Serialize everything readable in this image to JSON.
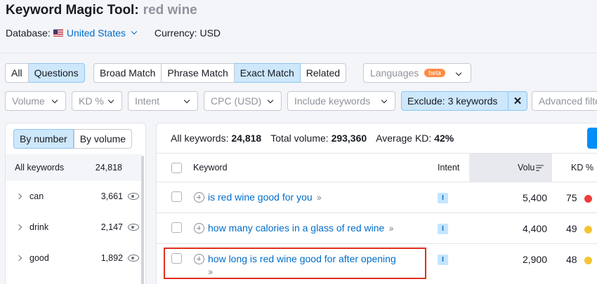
{
  "header": {
    "tool_title": "Keyword Magic Tool:",
    "query": "red wine",
    "database_label": "Database:",
    "database_value": "United States",
    "currency": "Currency: USD"
  },
  "tabs_scope": [
    "All",
    "Questions"
  ],
  "tabs_match": [
    "Broad Match",
    "Phrase Match",
    "Exact Match",
    "Related"
  ],
  "languages": {
    "label": "Languages",
    "badge": "beta"
  },
  "filters": {
    "volume": "Volume",
    "kd": "KD %",
    "intent": "Intent",
    "cpc": "CPC (USD)",
    "include": "Include keywords",
    "exclude": "Exclude: 3 keywords",
    "advanced": "Advanced filters"
  },
  "sidebar": {
    "by_number": "By number",
    "by_volume": "By volume",
    "all_label": "All keywords",
    "all_count": "24,818",
    "groups": [
      {
        "name": "can",
        "count": "3,661"
      },
      {
        "name": "drink",
        "count": "2,147"
      },
      {
        "name": "good",
        "count": "1,892"
      }
    ]
  },
  "summary": {
    "all_label": "All keywords:",
    "all_value": "24,818",
    "vol_label": "Total volume:",
    "vol_value": "293,360",
    "kd_label": "Average KD:",
    "kd_value": "42%"
  },
  "table": {
    "headers": {
      "keyword": "Keyword",
      "intent": "Intent",
      "volume": "Volu",
      "kd": "KD %"
    },
    "rows": [
      {
        "keyword": "is red wine good for you",
        "intent": "I",
        "volume": "5,400",
        "kd": "75",
        "kd_color": "#ed3d3d"
      },
      {
        "keyword": "how many calories in a glass of red wine",
        "intent": "I",
        "volume": "4,400",
        "kd": "49",
        "kd_color": "#f5c431"
      },
      {
        "keyword": "how long is red wine good for after opening",
        "intent": "I",
        "volume": "2,900",
        "kd": "48",
        "kd_color": "#f5c431"
      }
    ]
  },
  "colors": {
    "accent": "#006dca",
    "active_chip": "#cde7fb",
    "highlight": "#e0301e"
  }
}
